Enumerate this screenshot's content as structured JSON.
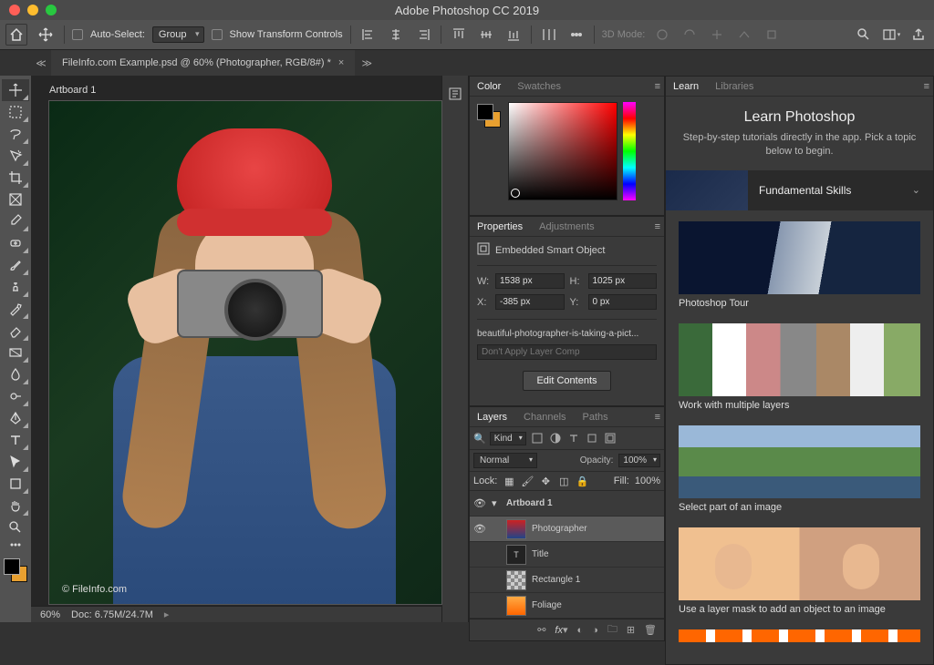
{
  "app_title": "Adobe Photoshop CC 2019",
  "options_bar": {
    "auto_select_label": "Auto-Select:",
    "auto_select_value": "Group",
    "show_transform_label": "Show Transform Controls",
    "mode_3d_label": "3D Mode:"
  },
  "document": {
    "tab_title": "FileInfo.com Example.psd @ 60% (Photographer, RGB/8#) *",
    "artboard_label": "Artboard 1",
    "zoom": "60%",
    "doc_size": "Doc: 6.75M/24.7M",
    "watermark": "© FileInfo.com"
  },
  "panels": {
    "color": {
      "tab1": "Color",
      "tab2": "Swatches"
    },
    "properties": {
      "tab1": "Properties",
      "tab2": "Adjustments",
      "header": "Embedded Smart Object",
      "w_label": "W:",
      "w_val": "1538 px",
      "h_label": "H:",
      "h_val": "1025 px",
      "x_label": "X:",
      "x_val": "-385 px",
      "y_label": "Y:",
      "y_val": "0 px",
      "filename": "beautiful-photographer-is-taking-a-pict...",
      "layer_comp": "Don't Apply Layer Comp",
      "edit_btn": "Edit Contents"
    },
    "layers": {
      "tab1": "Layers",
      "tab2": "Channels",
      "tab3": "Paths",
      "kind": "Kind",
      "blend": "Normal",
      "opacity_label": "Opacity:",
      "opacity_val": "100%",
      "lock_label": "Lock:",
      "fill_label": "Fill:",
      "fill_val": "100%",
      "items": [
        {
          "name": "Artboard 1",
          "type": "artboard"
        },
        {
          "name": "Photographer",
          "type": "photo"
        },
        {
          "name": "Title",
          "type": "text"
        },
        {
          "name": "Rectangle 1",
          "type": "shape"
        },
        {
          "name": "Foliage",
          "type": "image"
        }
      ]
    },
    "learn": {
      "tab1": "Learn",
      "tab2": "Libraries",
      "title": "Learn Photoshop",
      "subtitle": "Step-by-step tutorials directly in the app. Pick a topic below to begin.",
      "category": "Fundamental Skills",
      "cards": [
        "Photoshop Tour",
        "Work with multiple layers",
        "Select part of an image",
        "Use a layer mask to add an object to an image"
      ]
    }
  }
}
